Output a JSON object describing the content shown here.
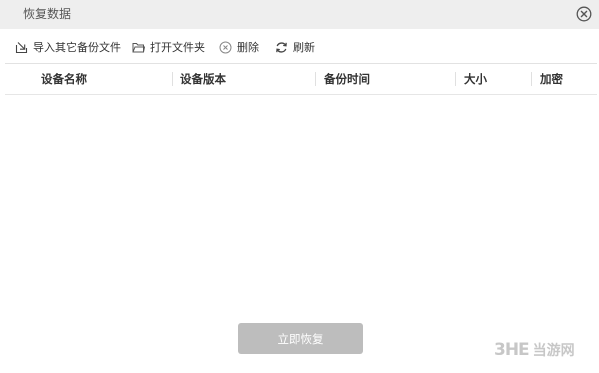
{
  "window": {
    "title": "恢复数据",
    "close_icon": "close-circle-icon"
  },
  "toolbar": {
    "import_label": "导入其它备份文件",
    "import_icon": "import-icon",
    "open_folder_label": "打开文件夹",
    "open_folder_icon": "folder-icon",
    "delete_label": "删除",
    "delete_icon": "delete-circle-icon",
    "refresh_label": "刷新",
    "refresh_icon": "refresh-icon"
  },
  "table": {
    "columns": [
      "设备名称",
      "设备版本",
      "备份时间",
      "大小",
      "加密"
    ],
    "rows": []
  },
  "footer": {
    "restore_label": "立即恢复"
  },
  "watermark": {
    "logo": "3HE",
    "text": "当游网"
  },
  "colors": {
    "titlebar_bg": "#eeeeee",
    "button_disabled_bg": "#bdbdbd",
    "divider": "#e2e2e2"
  }
}
